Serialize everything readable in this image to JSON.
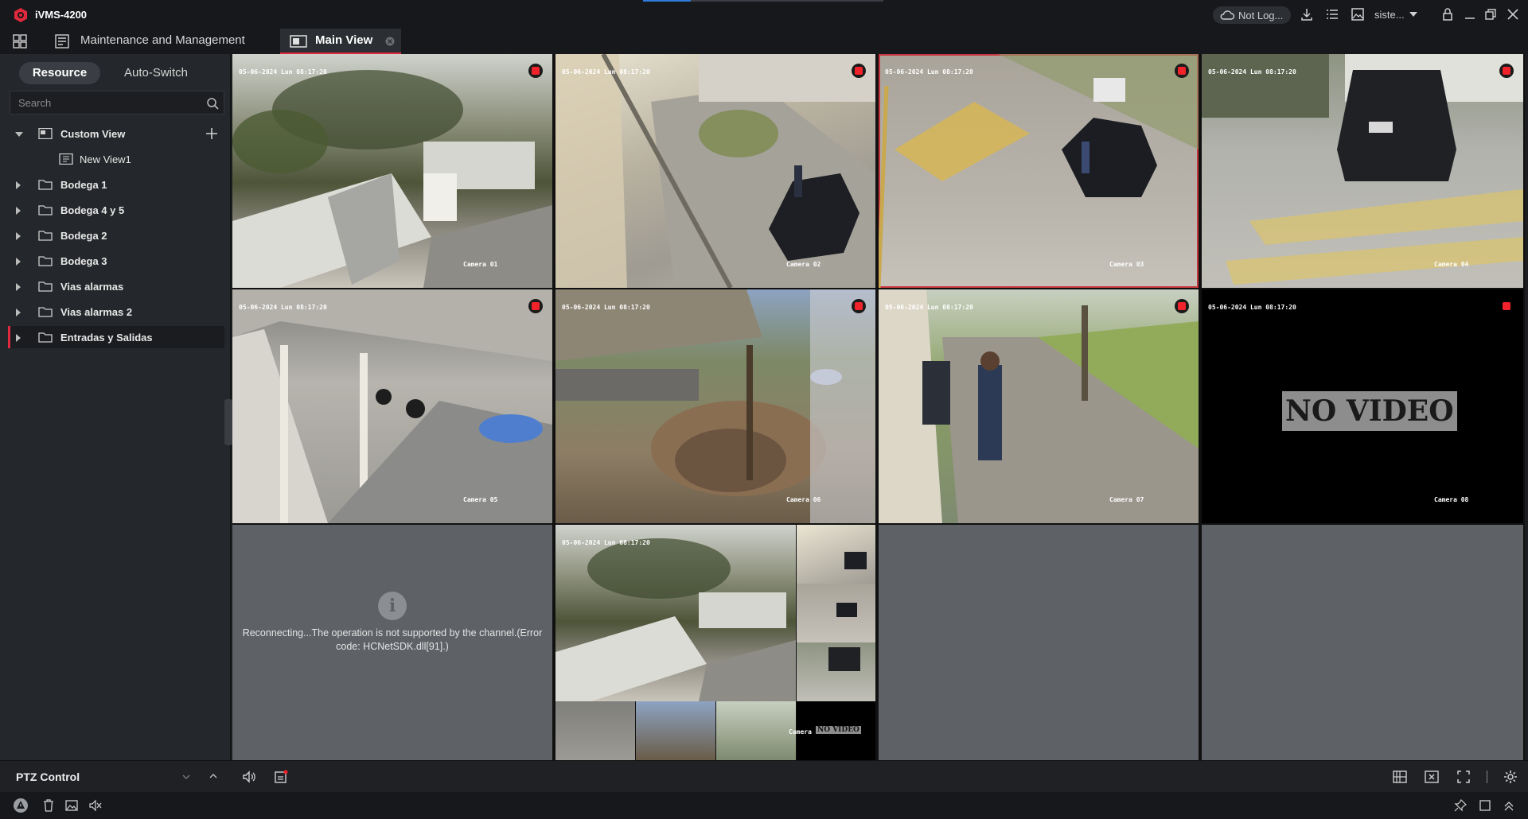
{
  "app": {
    "title": "iVMS-4200"
  },
  "titlebar": {
    "cloud_status": "Not Log...",
    "user": "siste..."
  },
  "tabs": [
    {
      "label": "Maintenance and Management"
    },
    {
      "label": "Main View"
    }
  ],
  "left_panel": {
    "segments": [
      "Resource",
      "Auto-Switch"
    ],
    "active_segment": "Resource",
    "search_placeholder": "Search",
    "tree": [
      {
        "label": "Custom View",
        "expanded": true
      },
      {
        "label": "New View1",
        "child": true
      },
      {
        "label": "Bodega 1"
      },
      {
        "label": "Bodega 4 y 5"
      },
      {
        "label": "Bodega 2"
      },
      {
        "label": "Bodega 3"
      },
      {
        "label": "Vias alarmas"
      },
      {
        "label": "Vias alarmas 2"
      },
      {
        "label": "Entradas y Salidas",
        "selected": true
      }
    ],
    "ptz_label": "PTZ Control"
  },
  "grid": {
    "osd_time": "05-06-2024 Lun 08:17:20",
    "tiles": [
      {
        "camera": "Camera 01",
        "recording": true
      },
      {
        "camera": "Camera 02",
        "recording": true
      },
      {
        "camera": "Camera 03",
        "recording": true,
        "selected": true
      },
      {
        "camera": "Camera 04",
        "recording": true
      },
      {
        "camera": "Camera 05",
        "recording": true
      },
      {
        "camera": "Camera 06",
        "recording": true
      },
      {
        "camera": "Camera 07",
        "recording": true
      },
      {
        "camera": "Camera 08",
        "recording": true,
        "no_video": "NO VIDEO"
      }
    ],
    "error_message": "Reconnecting...The operation is not supported by the channel.(Error code: HCNetSDK.dll[91].)",
    "mosaic_tile_label": "Camera 0",
    "mosaic_no_video": "NO VIDEO",
    "colors": {
      "record": "#f0222a",
      "selected_border": "#c8373f",
      "accent": "#e0293c"
    }
  }
}
